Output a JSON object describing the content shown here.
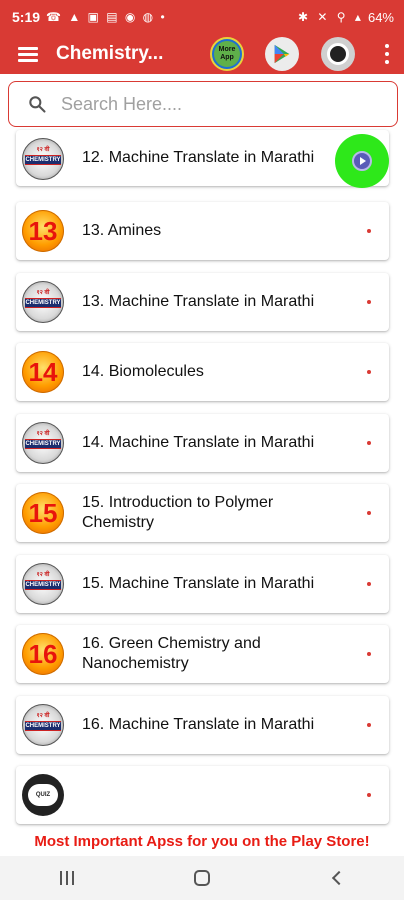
{
  "status_bar": {
    "time": "5:19",
    "left_icons": "☎ ▲ ▣ ▤ ◉ ◍ •",
    "right_icons": "✱ ✕ ⚲ ▴",
    "battery": "64%"
  },
  "app_bar": {
    "title": "Chemistry...",
    "more_app_label": "More App"
  },
  "search": {
    "placeholder": "Search Here...."
  },
  "items": [
    {
      "label": "12. Machine Translate in Marathi",
      "badge_type": "logo"
    },
    {
      "label": "13. Amines",
      "badge_type": "number",
      "badge": "13"
    },
    {
      "label": "13. Machine Translate in Marathi",
      "badge_type": "logo"
    },
    {
      "label": "14. Biomolecules",
      "badge_type": "number",
      "badge": "14"
    },
    {
      "label": "14. Machine Translate in Marathi",
      "badge_type": "logo"
    },
    {
      "label": "15. Introduction to Polymer Chemistry",
      "badge_type": "number",
      "badge": "15"
    },
    {
      "label": "15. Machine Translate in Marathi",
      "badge_type": "logo"
    },
    {
      "label": "16. Green Chemistry and Nanochemistry",
      "badge_type": "number",
      "badge": "16"
    },
    {
      "label": "16. Machine Translate in Marathi",
      "badge_type": "logo"
    },
    {
      "label": "",
      "badge_type": "quiz"
    }
  ],
  "logo_badge": {
    "top_text": "१२ वी",
    "band_text": "CHEMISTRY"
  },
  "quiz_badge": {
    "text": "QUIZ"
  },
  "footer": {
    "text": "Most Important Apss for you on the Play Store!"
  },
  "colors": {
    "primary": "#d93a34",
    "accent_green": "#2ee81a"
  }
}
